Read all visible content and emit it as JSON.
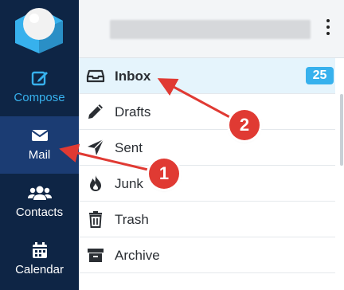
{
  "sidebar": {
    "items": [
      {
        "label": "Compose",
        "icon": "compose-icon"
      },
      {
        "label": "Mail",
        "icon": "mail-icon"
      },
      {
        "label": "Contacts",
        "icon": "contacts-icon"
      },
      {
        "label": "Calendar",
        "icon": "calendar-icon"
      }
    ]
  },
  "header": {
    "title": ""
  },
  "folders": [
    {
      "label": "Inbox",
      "icon": "inbox-icon",
      "count": "25"
    },
    {
      "label": "Drafts",
      "icon": "pencil-icon"
    },
    {
      "label": "Sent",
      "icon": "send-icon"
    },
    {
      "label": "Junk",
      "icon": "fire-icon"
    },
    {
      "label": "Trash",
      "icon": "trash-icon"
    },
    {
      "label": "Archive",
      "icon": "archive-icon"
    }
  ],
  "annotations": {
    "step1": "1",
    "step2": "2"
  },
  "colors": {
    "sidebar": "#0e2545",
    "sidebar_active": "#1b3c73",
    "accent": "#37b1ed",
    "annotation": "#e03a33"
  }
}
